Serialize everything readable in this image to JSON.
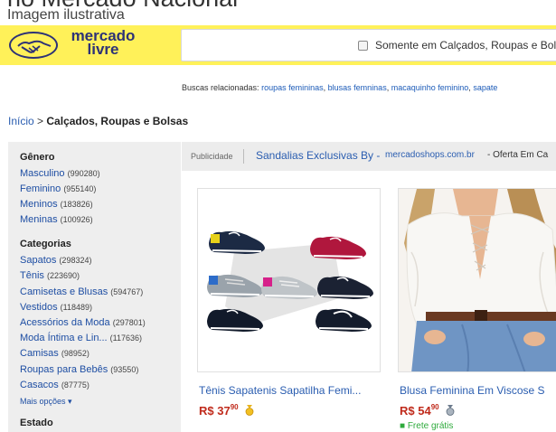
{
  "caption": {
    "heading": "no Mercado Nacional",
    "subtitle": "Imagem ilustrativa"
  },
  "header": {
    "logo_line1": "mercado",
    "logo_line2": "livre",
    "search_checkbox_label": "Somente em Calçados, Roupas e Bol"
  },
  "related": {
    "label": "Buscas relacionadas:",
    "items": [
      "roupas femininas",
      "blusas femninas",
      "macaquinho feminino",
      "sapate"
    ],
    "separator": ","
  },
  "breadcrumb": {
    "home": "Início",
    "separator": ">",
    "current": "Calçados, Roupas e Bolsas"
  },
  "sidebar": {
    "genero": {
      "title": "Gênero",
      "items": [
        {
          "label": "Masculino",
          "count": "(990280)"
        },
        {
          "label": "Feminino",
          "count": "(955140)"
        },
        {
          "label": "Meninos",
          "count": "(183826)"
        },
        {
          "label": "Meninas",
          "count": "(100926)"
        }
      ]
    },
    "categorias": {
      "title": "Categorias",
      "items": [
        {
          "label": "Sapatos",
          "count": "(298324)"
        },
        {
          "label": "Tênis",
          "count": "(223690)"
        },
        {
          "label": "Camisetas e Blusas",
          "count": "(594767)"
        },
        {
          "label": "Vestidos",
          "count": "(118489)"
        },
        {
          "label": "Acessórios da Moda",
          "count": "(297801)"
        },
        {
          "label": "Moda Íntima e Lin...",
          "count": "(117636)"
        },
        {
          "label": "Camisas",
          "count": "(98952)"
        },
        {
          "label": "Roupas para Bebês",
          "count": "(93550)"
        },
        {
          "label": "Casacos",
          "count": "(87775)"
        }
      ]
    },
    "more_options": "Mais opções",
    "estado": {
      "title": "Estado"
    }
  },
  "ad": {
    "label": "Publicidade",
    "title": "Sandalias Exclusivas By -",
    "domain": "mercadoshops.com.br",
    "offer": "- Oferta Em Ca"
  },
  "products": [
    {
      "title": "Tênis Sapatenis Sapatilha Femi...",
      "price_currency": "R$",
      "price_int": "37",
      "price_cents": "90",
      "medal": "gold",
      "free_shipping": ""
    },
    {
      "title": "Blusa Feminina Em Viscose S",
      "price_currency": "R$",
      "price_int": "54",
      "price_cents": "90",
      "medal": "silver",
      "free_shipping": "Frete grátis"
    }
  ],
  "colors": {
    "header_bg": "#fff159",
    "logo_blue": "#2d3277",
    "link_blue": "#2a5db0",
    "price_red": "#c02b1c",
    "ship_green": "#2eaa3c"
  }
}
